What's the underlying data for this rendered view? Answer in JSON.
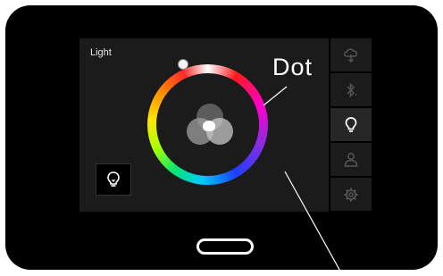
{
  "screen": {
    "title": "Light"
  },
  "callout": {
    "label": "Dot"
  },
  "sidebar": {
    "items": [
      {
        "icon": "cloud-upload-icon",
        "active": false
      },
      {
        "icon": "bluetooth-icon",
        "active": false
      },
      {
        "icon": "lightbulb-icon",
        "active": true
      },
      {
        "icon": "person-icon",
        "active": false
      },
      {
        "icon": "gear-icon",
        "active": false
      }
    ]
  },
  "colors": {
    "background": "#1b1b1b",
    "device": "#000000",
    "active_icon": "#ffffff",
    "inactive_icon": "#555555"
  }
}
